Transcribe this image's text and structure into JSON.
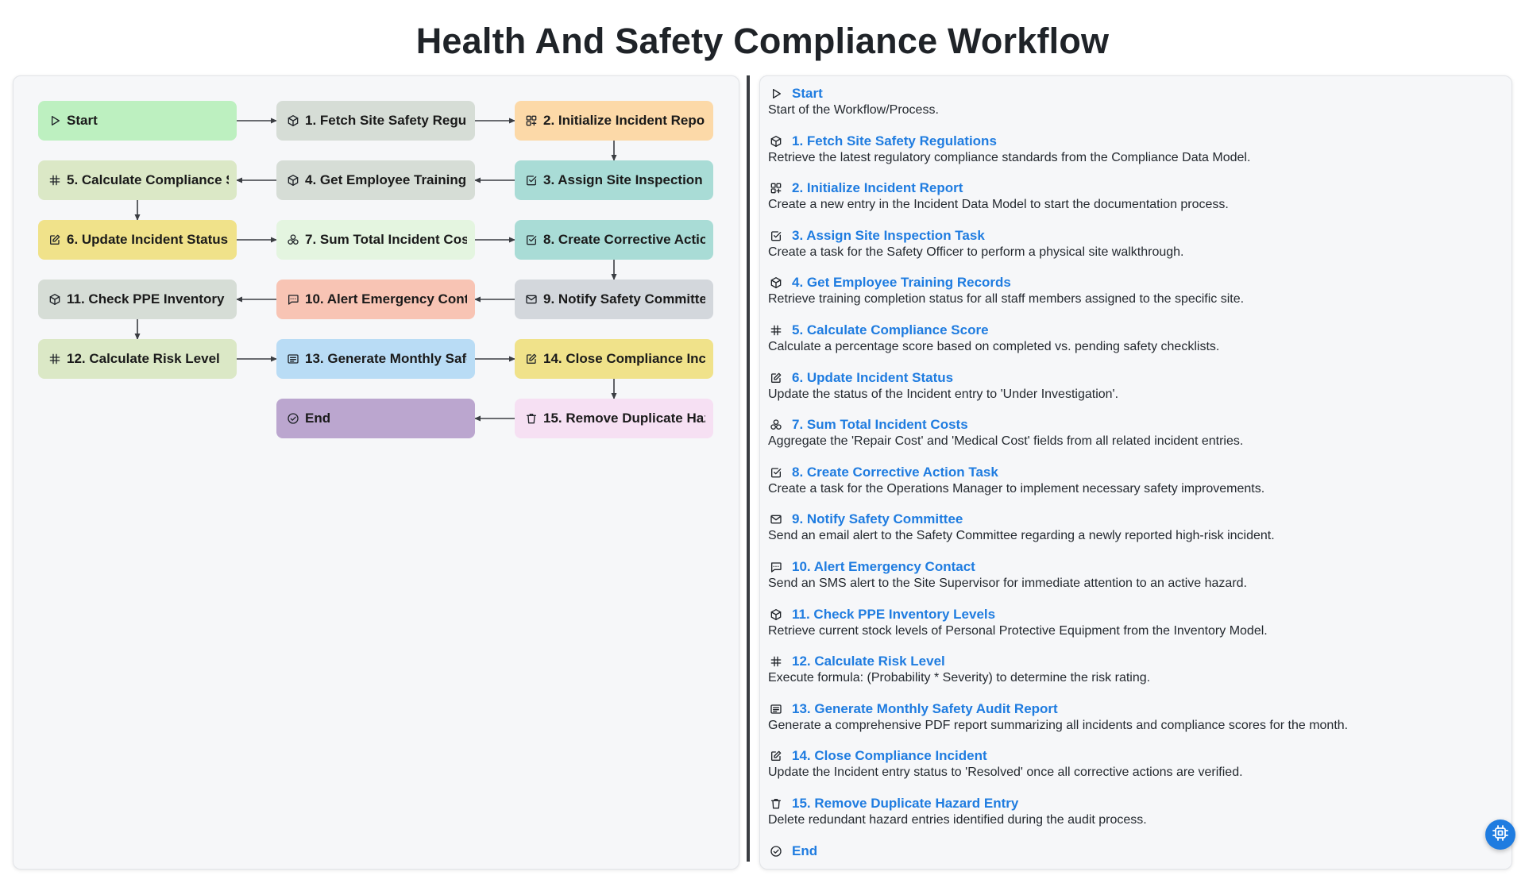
{
  "title": "Health And Safety Compliance Workflow",
  "nodes": [
    {
      "id": "start",
      "label": "Start",
      "icon": "play-icon",
      "color": "#bdf0c0"
    },
    {
      "id": "n1",
      "label": "1. Fetch Site Safety Regulations",
      "icon": "cube-icon",
      "color": "#d6ddd6"
    },
    {
      "id": "n2",
      "label": "2. Initialize Incident Report",
      "icon": "grid-plus-icon",
      "color": "#fcd9a8"
    },
    {
      "id": "n3",
      "label": "3. Assign Site Inspection Task",
      "icon": "checkbox-icon",
      "color": "#a9dcd6"
    },
    {
      "id": "n4",
      "label": "4. Get Employee Training Records",
      "icon": "cube-icon",
      "color": "#d6ddd6"
    },
    {
      "id": "n5",
      "label": "5. Calculate Compliance Score",
      "icon": "hash-icon",
      "color": "#dbe8c6"
    },
    {
      "id": "n6",
      "label": "6. Update Incident Status",
      "icon": "edit-icon",
      "color": "#f0e28a"
    },
    {
      "id": "n7",
      "label": "7. Sum Total Incident Costs",
      "icon": "coins-icon",
      "color": "#e4f5e0"
    },
    {
      "id": "n8",
      "label": "8. Create Corrective Action Task",
      "icon": "checkbox-icon",
      "color": "#a9dcd6"
    },
    {
      "id": "n9",
      "label": "9. Notify Safety Committee",
      "icon": "mail-icon",
      "color": "#d3d7dc"
    },
    {
      "id": "n10",
      "label": "10. Alert Emergency Contact",
      "icon": "message-icon",
      "color": "#f8c4b4"
    },
    {
      "id": "n11",
      "label": "11. Check PPE Inventory Levels",
      "icon": "cube-icon",
      "color": "#d6ddd6"
    },
    {
      "id": "n12",
      "label": "12. Calculate Risk Level",
      "icon": "hash-icon",
      "color": "#dbe8c6"
    },
    {
      "id": "n13",
      "label": "13. Generate Monthly Safety Audit Report",
      "icon": "report-icon",
      "color": "#b9dcf5"
    },
    {
      "id": "n14",
      "label": "14. Close Compliance Incident",
      "icon": "edit-icon",
      "color": "#f0e28a"
    },
    {
      "id": "n15",
      "label": "15. Remove Duplicate Hazard Entry",
      "icon": "trash-icon",
      "color": "#f6e0f3"
    },
    {
      "id": "end",
      "label": "End",
      "icon": "check-circle-icon",
      "color": "#bba6cf"
    }
  ],
  "steps": [
    {
      "title": "Start",
      "icon": "play-icon",
      "desc": "Start of the Workflow/Process."
    },
    {
      "title": "1. Fetch Site Safety Regulations",
      "icon": "cube-icon",
      "desc": "Retrieve the latest regulatory compliance standards from the Compliance Data Model."
    },
    {
      "title": "2. Initialize Incident Report",
      "icon": "grid-plus-icon",
      "desc": "Create a new entry in the Incident Data Model to start the documentation process."
    },
    {
      "title": "3. Assign Site Inspection Task",
      "icon": "checkbox-icon",
      "desc": "Create a task for the Safety Officer to perform a physical site walkthrough."
    },
    {
      "title": "4. Get Employee Training Records",
      "icon": "cube-icon",
      "desc": "Retrieve training completion status for all staff members assigned to the specific site."
    },
    {
      "title": "5. Calculate Compliance Score",
      "icon": "hash-icon",
      "desc": "Calculate a percentage score based on completed vs. pending safety checklists."
    },
    {
      "title": "6. Update Incident Status",
      "icon": "edit-icon",
      "desc": "Update the status of the Incident entry to 'Under Investigation'."
    },
    {
      "title": "7. Sum Total Incident Costs",
      "icon": "coins-icon",
      "desc": "Aggregate the 'Repair Cost' and 'Medical Cost' fields from all related incident entries."
    },
    {
      "title": "8. Create Corrective Action Task",
      "icon": "checkbox-icon",
      "desc": "Create a task for the Operations Manager to implement necessary safety improvements."
    },
    {
      "title": "9. Notify Safety Committee",
      "icon": "mail-icon",
      "desc": "Send an email alert to the Safety Committee regarding a newly reported high-risk incident."
    },
    {
      "title": "10. Alert Emergency Contact",
      "icon": "message-icon",
      "desc": "Send an SMS alert to the Site Supervisor for immediate attention to an active hazard."
    },
    {
      "title": "11. Check PPE Inventory Levels",
      "icon": "cube-icon",
      "desc": "Retrieve current stock levels of Personal Protective Equipment from the Inventory Model."
    },
    {
      "title": "12. Calculate Risk Level",
      "icon": "hash-icon",
      "desc": "Execute formula: (Probability * Severity) to determine the risk rating."
    },
    {
      "title": "13. Generate Monthly Safety Audit Report",
      "icon": "report-icon",
      "desc": "Generate a comprehensive PDF report summarizing all incidents and compliance scores for the month."
    },
    {
      "title": "14. Close Compliance Incident",
      "icon": "edit-icon",
      "desc": "Update the Incident entry status to 'Resolved' once all corrective actions are verified."
    },
    {
      "title": "15. Remove Duplicate Hazard Entry",
      "icon": "trash-icon",
      "desc": "Delete redundant hazard entries identified during the audit process."
    },
    {
      "title": "End",
      "icon": "check-circle-icon",
      "desc": ""
    }
  ],
  "fab_icon": "chip-icon",
  "link_color": "#1f7ce0"
}
